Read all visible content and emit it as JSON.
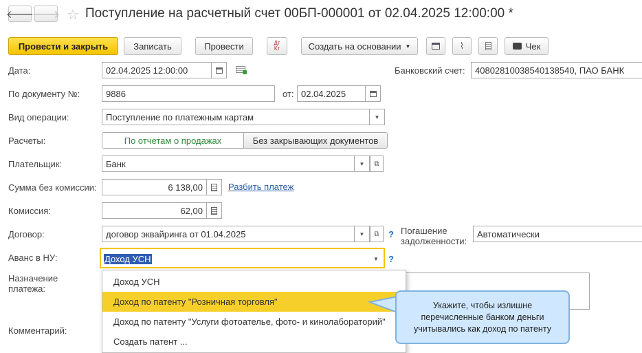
{
  "window": {
    "title": "Поступление на расчетный счет 00БП-000001 от 02.04.2025 12:00:00 *"
  },
  "nav": {
    "back": "🡐",
    "forward": "🡒",
    "favorite": "☆"
  },
  "toolbar": {
    "post_close": "Провести и закрыть",
    "save": "Записать",
    "post": "Провести",
    "create_based": "Создать на основании",
    "dtkt": "Дт Кт",
    "check": "Чек"
  },
  "form": {
    "date_label": "Дата:",
    "date_value": "02.04.2025 12:00:00",
    "bank_account_label": "Банковский счет:",
    "bank_account_value": "40802810038540138540, ПАО БАНК",
    "doc_number_label": "По документу №:",
    "doc_number_value": "9886",
    "doc_date_label": "от:",
    "doc_date_value": "02.04.2025",
    "operation_label": "Вид операции:",
    "operation_value": "Поступление по платежным картам",
    "settlements_label": "Расчеты:",
    "settlements_opt1": "По отчетам о продажах",
    "settlements_opt2": "Без закрывающих документов",
    "payer_label": "Плательщик:",
    "payer_value": "Банк",
    "amount_label": "Сумма без комиссии:",
    "amount_value": "6 138,00",
    "split_link": "Разбить платеж",
    "commission_label": "Комиссия:",
    "commission_value": "62,00",
    "contract_label": "Договор:",
    "contract_value": "договор эквайринга от 01.04.2025",
    "help_mark": "?",
    "repayment_label_1": "Погашение",
    "repayment_label_2": "задолженности:",
    "repayment_value": "Автоматически",
    "advance_label": "Аванс в НУ:",
    "advance_value": "Доход УСН",
    "purpose_label_1": "Назначение",
    "purpose_label_2": "платежа:",
    "comment_label": "Комментарий:"
  },
  "dropdown": {
    "items": [
      "Доход УСН",
      "Доход по патенту \"Розничная торговля\"",
      "Доход по патенту \"Услуги фотоателье, фото- и кинолабораторий\"",
      "Создать патент ..."
    ],
    "selected_index": 1
  },
  "callout": {
    "text": "Укажите, чтобы излишне перечисленные банком деньги учитывались как доход по патенту"
  },
  "colors": {
    "accent": "#f5c400",
    "selected": "#f7cf2b",
    "callout_bg": "#cfe8ff",
    "link": "#2b5fa6",
    "active_green": "#2e8b3a"
  }
}
